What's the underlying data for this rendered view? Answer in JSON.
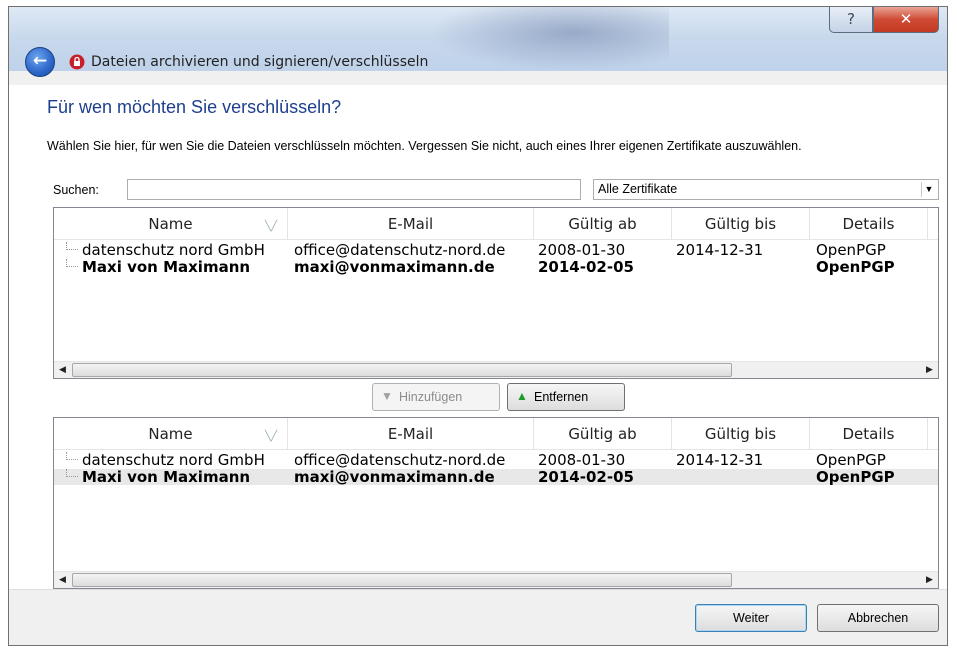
{
  "window": {
    "title": "Dateien archivieren und signieren/verschlüsseln",
    "help_glyph": "?",
    "close_glyph": "✕",
    "back_glyph": "←"
  },
  "page": {
    "heading": "Für wen möchten Sie verschlüsseln?",
    "description": "Wählen Sie hier, für wen Sie die Dateien verschlüsseln möchten. Vergessen Sie nicht, auch eines Ihrer eigenen Zertifikate auszuwählen."
  },
  "search": {
    "label": "Suchen:",
    "value": "",
    "filter_selected": "Alle Zertifikate"
  },
  "columns": [
    "Name",
    "E-Mail",
    "Gültig ab",
    "Gültig bis",
    "Details"
  ],
  "available_list": [
    {
      "name": "datenschutz nord GmbH",
      "email": "office@datenschutz-nord.de",
      "valid_from": "2008-01-30",
      "valid_to": "2014-12-31",
      "details": "OpenPGP",
      "bold": false
    },
    {
      "name": "Maxi von Maximann",
      "email": "maxi@vonmaximann.de",
      "valid_from": "2014-02-05",
      "valid_to": "",
      "details": "OpenPGP",
      "bold": true
    }
  ],
  "selected_list": [
    {
      "name": "datenschutz nord GmbH",
      "email": "office@datenschutz-nord.de",
      "valid_from": "2008-01-30",
      "valid_to": "2014-12-31",
      "details": "OpenPGP",
      "bold": false
    },
    {
      "name": "Maxi von Maximann",
      "email": "maxi@vonmaximann.de",
      "valid_from": "2014-02-05",
      "valid_to": "",
      "details": "OpenPGP",
      "bold": true
    }
  ],
  "buttons": {
    "add": "Hinzufügen",
    "remove": "Entfernen",
    "next": "Weiter",
    "cancel": "Abbrechen"
  },
  "colors": {
    "heading": "#1e3f8f",
    "remove_arrow": "#1e9a2e",
    "close_button": "#c23a22"
  }
}
